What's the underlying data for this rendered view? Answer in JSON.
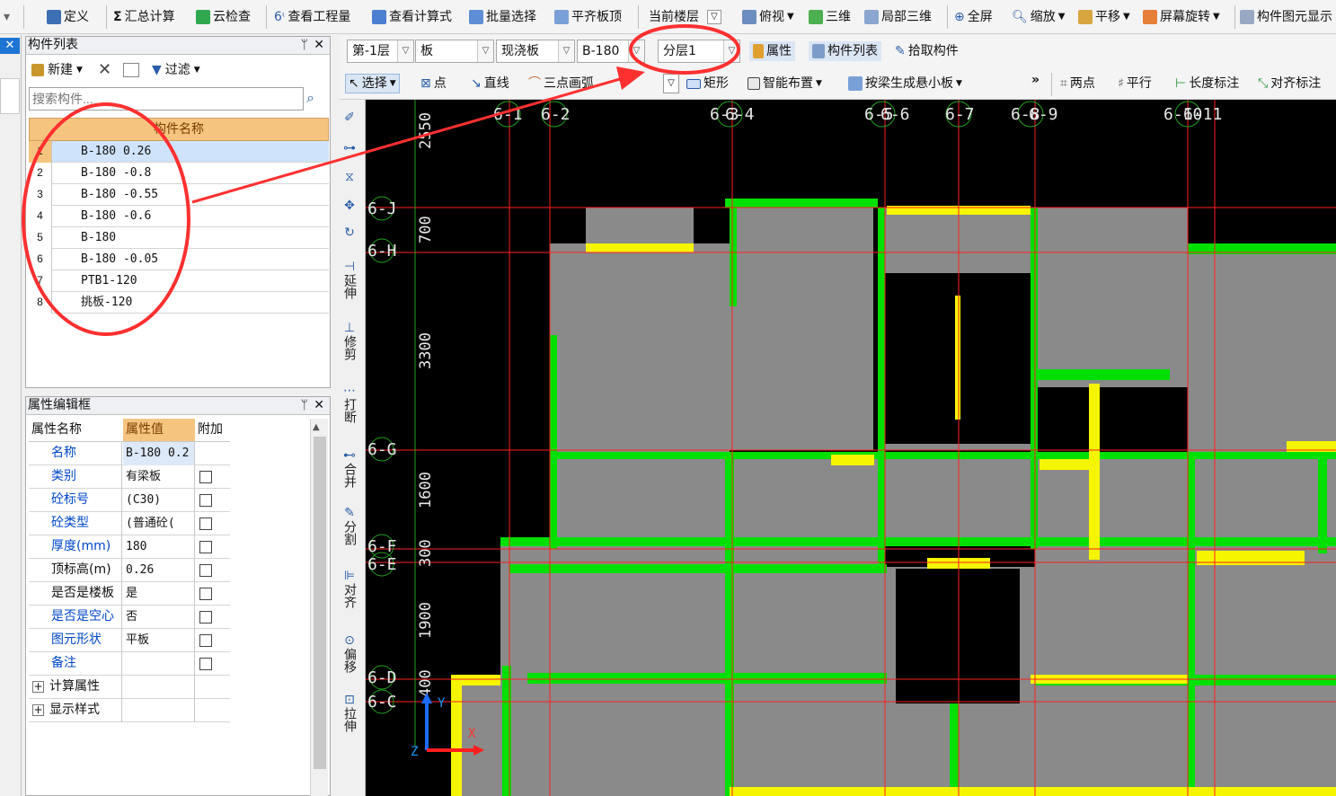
{
  "toolbar1": {
    "items": [
      {
        "label": "定义",
        "icon": "define-icon"
      },
      {
        "label": "汇总计算",
        "icon": "sigma-icon"
      },
      {
        "label": "云检查",
        "icon": "cloud-check-icon"
      },
      {
        "label": "查看工程量",
        "icon": "view-quantity-icon"
      },
      {
        "label": "查看计算式",
        "icon": "formula-icon"
      },
      {
        "label": "批量选择",
        "icon": "batch-select-icon"
      },
      {
        "label": "平齐板顶",
        "icon": "align-top-icon"
      },
      {
        "label": "当前楼层"
      },
      {
        "label": "俯视",
        "icon": "top-view-icon"
      },
      {
        "label": "三维",
        "icon": "3d-icon"
      },
      {
        "label": "局部三维",
        "icon": "local-3d-icon"
      },
      {
        "label": "全屏",
        "icon": "fullscreen-icon"
      },
      {
        "label": "缩放",
        "icon": "zoom-icon"
      },
      {
        "label": "平移",
        "icon": "pan-icon"
      },
      {
        "label": "屏幕旋转",
        "icon": "rotate-screen-icon"
      },
      {
        "label": "构件图元显示",
        "icon": "display-icon"
      }
    ]
  },
  "toolbar2": {
    "floor": "第-1层",
    "type": "板",
    "subtype": "现浇板",
    "component": "B-180",
    "layer": "分层1",
    "buttons": [
      {
        "label": "属性"
      },
      {
        "label": "构件列表"
      },
      {
        "label": "拾取构件"
      }
    ]
  },
  "toolbar3": {
    "buttons": [
      {
        "label": "选择"
      },
      {
        "label": "点"
      },
      {
        "label": "直线"
      },
      {
        "label": "三点画弧"
      },
      {
        "label": "矩形"
      },
      {
        "label": "智能布置"
      },
      {
        "label": "按梁生成悬小板"
      },
      {
        "label": "两点"
      },
      {
        "label": "平行"
      },
      {
        "label": "长度标注"
      },
      {
        "label": "对齐标注"
      }
    ],
    "more": "»"
  },
  "component_list": {
    "title": "构件列表",
    "pin": "ᛘ",
    "close": "✕",
    "new": "新建",
    "delete": "✕",
    "filter": "过滤",
    "search_placeholder": "搜索构件...",
    "column": "构件名称",
    "rows": [
      {
        "n": "1",
        "name": "B-180 0.26"
      },
      {
        "n": "2",
        "name": "B-180 -0.8"
      },
      {
        "n": "3",
        "name": "B-180 -0.55"
      },
      {
        "n": "4",
        "name": "B-180 -0.6"
      },
      {
        "n": "5",
        "name": "B-180"
      },
      {
        "n": "6",
        "name": "B-180 -0.05"
      },
      {
        "n": "7",
        "name": "PTB1-120"
      },
      {
        "n": "8",
        "name": "挑板-120"
      }
    ]
  },
  "property_editor": {
    "title": "属性编辑框",
    "pin": "ᛘ",
    "close": "✕",
    "headers": [
      "属性名称",
      "属性值",
      "附加"
    ],
    "rows": [
      {
        "name": "名称",
        "value": "B-180 0.2",
        "blue": true,
        "check": false
      },
      {
        "name": "类别",
        "value": "有梁板",
        "blue": true,
        "check": true
      },
      {
        "name": "砼标号",
        "value": "(C30)",
        "blue": true,
        "check": true
      },
      {
        "name": "砼类型",
        "value": "(普通砼(",
        "blue": true,
        "check": true
      },
      {
        "name": "厚度(mm)",
        "value": "180",
        "blue": true,
        "check": true
      },
      {
        "name": "顶标高(m)",
        "value": "0.26",
        "blue": false,
        "check": true
      },
      {
        "name": "是否是楼板",
        "value": "是",
        "blue": false,
        "check": true
      },
      {
        "name": "是否是空心",
        "value": "否",
        "blue": true,
        "check": true
      },
      {
        "name": "图元形状",
        "value": "平板",
        "blue": true,
        "check": true
      },
      {
        "name": "备注",
        "value": "",
        "blue": true,
        "check": true
      },
      {
        "name": "计算属性",
        "value": "",
        "blue": false,
        "check": false,
        "group": true
      },
      {
        "name": "显示样式",
        "value": "",
        "blue": false,
        "check": false,
        "group": true
      }
    ]
  },
  "vertical_tools": [
    {
      "label": "延伸"
    },
    {
      "label": "修剪"
    },
    {
      "label": "打断"
    },
    {
      "label": "合并"
    },
    {
      "label": "分割"
    },
    {
      "label": "对齐"
    },
    {
      "label": "偏移"
    },
    {
      "label": "拉伸"
    }
  ],
  "cad": {
    "top_axes": [
      "6-1",
      "6-2",
      "6-3",
      "6-4",
      "6-5",
      "6-6",
      "6-7",
      "6-8",
      "6-9",
      "6-10",
      "6-11"
    ],
    "left_axes": [
      "6-J",
      "6-H",
      "6-G",
      "6-F",
      "6-E",
      "6-D",
      "6-C"
    ],
    "dims": [
      "2550",
      "700",
      "3300",
      "1600",
      "300",
      "1900",
      "400"
    ],
    "axis_y": "Y",
    "axis_x": "X",
    "axis_z": "Z",
    "colors": {
      "slab": "#8a8a8a",
      "beam": "#00e000",
      "wall": "#ffff00",
      "grid": "#ff2020",
      "annot": "#ff3030"
    }
  }
}
